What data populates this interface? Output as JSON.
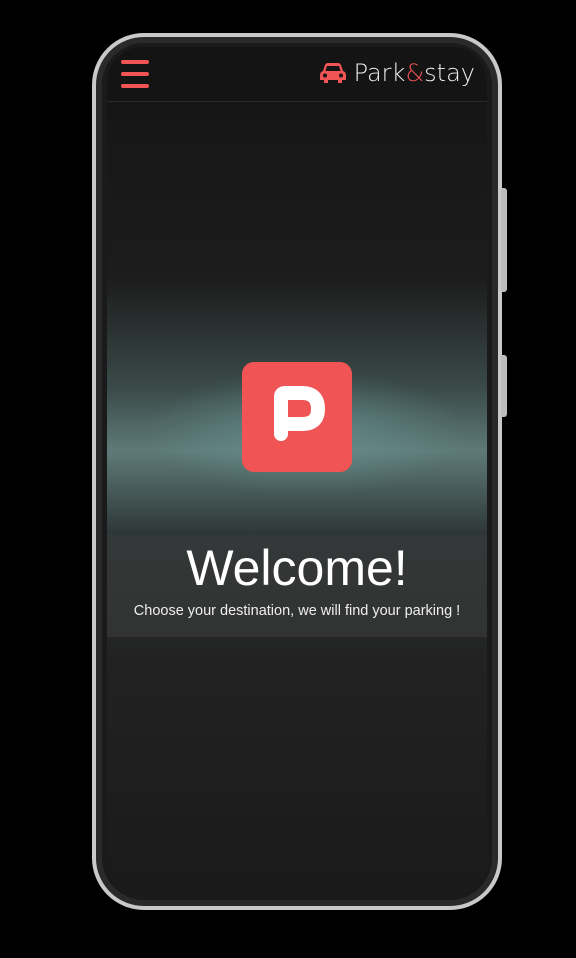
{
  "header": {
    "brand_prefix": "Park",
    "brand_amp": "&",
    "brand_suffix": "stay",
    "menu_icon": "hamburger-icon",
    "brand_icon": "car-icon"
  },
  "main": {
    "logo_letter": "P",
    "title": "Welcome!",
    "subtitle": "Choose your destination, we will find your parking !"
  },
  "colors": {
    "accent": "#f05454"
  }
}
